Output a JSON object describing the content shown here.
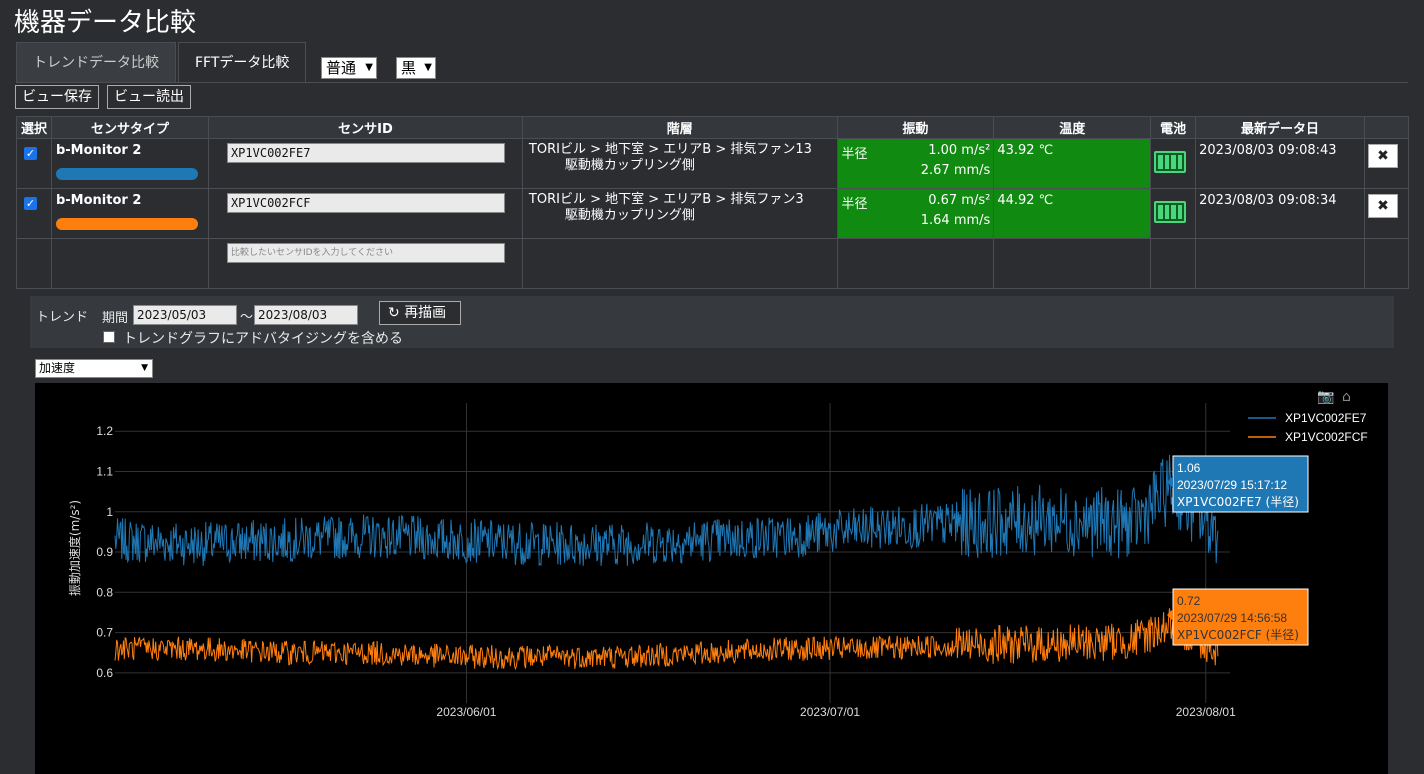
{
  "page": {
    "title": "機器データ比較"
  },
  "tabs": [
    {
      "label": "トレンドデータ比較",
      "active": false
    },
    {
      "label": "FFTデータ比較",
      "active": true
    }
  ],
  "selects": {
    "speed": "普通",
    "theme": "黒"
  },
  "buttons": {
    "save_view": "ビュー保存",
    "load_view": "ビュー読出"
  },
  "table": {
    "headers": [
      "選択",
      "センサタイプ",
      "センサID",
      "階層",
      "振動",
      "温度",
      "電池",
      "最新データ日"
    ],
    "rows": [
      {
        "checked": true,
        "sensor_type": "b-Monitor 2",
        "color": "#1f77b4",
        "sensor_id": "XP1VC002FE7",
        "hierarchy_1": "TORIビル > 地下室 > エリアB > 排気ファン13",
        "hierarchy_2": "駆動機カップリング側",
        "vib_label": "半径",
        "vib_accel": "1.00 m/s²",
        "vib_velocity": "2.67 mm/s",
        "temperature": "43.92 ℃",
        "battery": "full",
        "latest_date": "2023/08/03 09:08:43"
      },
      {
        "checked": true,
        "sensor_type": "b-Monitor 2",
        "color": "#ff7f0e",
        "sensor_id": "XP1VC002FCF",
        "hierarchy_1": "TORIビル > 地下室 > エリアB > 排気ファン3",
        "hierarchy_2": "駆動機カップリング側",
        "vib_label": "半径",
        "vib_accel": "0.67 m/s²",
        "vib_velocity": "1.64 mm/s",
        "temperature": "44.92 ℃",
        "battery": "full",
        "latest_date": "2023/08/03 09:08:34"
      }
    ],
    "new_row_placeholder": "比較したいセンサIDを入力してください"
  },
  "trend": {
    "label": "トレンド",
    "period_label": "期間",
    "from": "2023/05/03",
    "to": "2023/08/03",
    "tilde": "～",
    "redraw": "再描画",
    "include_advertising": "トレンドグラフにアドバタイジングを含める",
    "include_advertising_checked": false
  },
  "metric_select": "加速度",
  "chart_data": {
    "type": "line",
    "ylabel": "振動加速度(m/s²)",
    "xlabel": "",
    "x_range": [
      "2023-05-03",
      "2023-08-03"
    ],
    "x_ticks": [
      "2023/06/01",
      "2023/07/01",
      "2023/08/01"
    ],
    "y_ticks": [
      "0.6",
      "0.7",
      "0.8",
      "0.9",
      "1",
      "1.1",
      "1.2"
    ],
    "ylim": [
      0.55,
      1.27
    ],
    "background": "#000000",
    "legend_position": "top-right",
    "series": [
      {
        "name": "XP1VC002FE7",
        "color": "#1f77b4",
        "x": [
          "2023-05-03",
          "2023-05-10",
          "2023-05-17",
          "2023-05-24",
          "2023-05-31",
          "2023-06-07",
          "2023-06-14",
          "2023-06-21",
          "2023-06-28",
          "2023-07-05",
          "2023-07-12",
          "2023-07-19",
          "2023-07-26",
          "2023-07-29",
          "2023-08-02"
        ],
        "values": [
          0.93,
          0.92,
          0.93,
          0.94,
          0.93,
          0.92,
          0.92,
          0.93,
          0.94,
          0.96,
          0.97,
          0.98,
          0.97,
          1.06,
          0.95
        ]
      },
      {
        "name": "XP1VC002FCF",
        "color": "#ff7f0e",
        "x": [
          "2023-05-03",
          "2023-05-10",
          "2023-05-17",
          "2023-05-24",
          "2023-05-31",
          "2023-06-07",
          "2023-06-14",
          "2023-06-21",
          "2023-06-28",
          "2023-07-05",
          "2023-07-12",
          "2023-07-19",
          "2023-07-26",
          "2023-07-29",
          "2023-08-02"
        ],
        "values": [
          0.66,
          0.66,
          0.65,
          0.65,
          0.64,
          0.64,
          0.64,
          0.65,
          0.66,
          0.66,
          0.67,
          0.67,
          0.68,
          0.72,
          0.66
        ]
      }
    ],
    "tooltips": [
      {
        "value": "1.06",
        "date": "2023/07/29 15:17:12",
        "series": "XP1VC002FE7 (半径)",
        "color": "#1f77b4"
      },
      {
        "value": "0.72",
        "date": "2023/07/29 14:56:58",
        "series": "XP1VC002FCF (半径)",
        "color": "#ff7f0e"
      }
    ]
  }
}
